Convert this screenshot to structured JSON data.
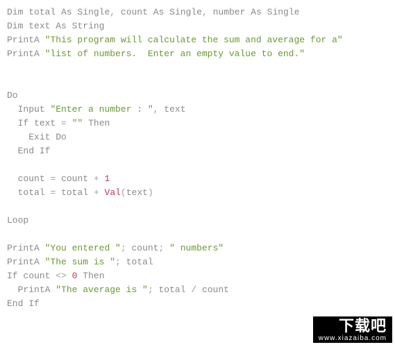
{
  "code": {
    "line1": {
      "dim": "Dim",
      "v1": "total",
      "as1": "As",
      "t1": "Single",
      "c1": ",",
      "v2": "count",
      "as2": "As",
      "t2": "Single",
      "c2": ",",
      "v3": "number",
      "as3": "As",
      "t3": "Single"
    },
    "line2": {
      "dim": "Dim",
      "v": "text",
      "as": "As",
      "t": "String"
    },
    "line3": {
      "p": "PrintA",
      "s": "\"This program will calculate the sum and average for a\""
    },
    "line4": {
      "p": "PrintA",
      "s": "\"list of numbers.  Enter an empty value to end.\""
    },
    "line7": {
      "do": "Do"
    },
    "line8": {
      "inp": "Input",
      "s": "\"Enter a number : \"",
      "c": ",",
      "v": "text"
    },
    "line9": {
      "if": "If",
      "v": "text",
      "eq": "=",
      "s": "\"\"",
      "then": "Then"
    },
    "line10": {
      "ex": "Exit Do"
    },
    "line11": {
      "ei": "End If"
    },
    "line13": {
      "v1": "count",
      "eq": "=",
      "v2": "count",
      "op": "+",
      "n": "1"
    },
    "line14": {
      "v1": "total",
      "eq": "=",
      "v2": "total",
      "op": "+",
      "fn": "Val",
      "lp": "(",
      "arg": "text",
      "rp": ")"
    },
    "line16": {
      "loop": "Loop"
    },
    "line18": {
      "p": "PrintA",
      "s1": "\"You entered \"",
      "sc1": ";",
      "v": "count",
      "sc2": ";",
      "s2": "\" numbers\""
    },
    "line19": {
      "p": "PrintA",
      "s": "\"The sum is \"",
      "sc": ";",
      "v": "total"
    },
    "line20": {
      "if": "If",
      "v": "count",
      "ne": "<>",
      "n": "0",
      "then": "Then"
    },
    "line21": {
      "p": "PrintA",
      "s": "\"The average is \"",
      "sc": ";",
      "v1": "total",
      "op": "/",
      "v2": "count"
    },
    "line22": {
      "ei": "End If"
    }
  },
  "watermark": {
    "big": "下载吧",
    "small": "www.xiazaiba.com"
  }
}
